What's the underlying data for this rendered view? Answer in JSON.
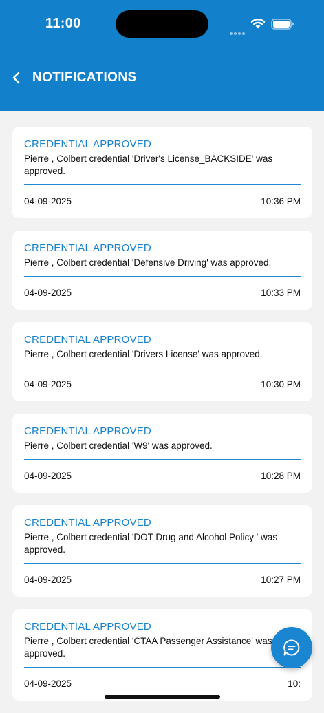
{
  "status_bar": {
    "time": "11:00"
  },
  "header": {
    "title": "NOTIFICATIONS"
  },
  "notifications": [
    {
      "title": "CREDENTIAL APPROVED",
      "message": "Pierre , Colbert  credential 'Driver's License_BACKSIDE' was approved.",
      "date": "04-09-2025",
      "time": "10:36 PM"
    },
    {
      "title": "CREDENTIAL APPROVED",
      "message": "Pierre , Colbert  credential 'Defensive Driving' was approved.",
      "date": "04-09-2025",
      "time": "10:33 PM"
    },
    {
      "title": "CREDENTIAL APPROVED",
      "message": "Pierre , Colbert  credential 'Drivers License' was approved.",
      "date": "04-09-2025",
      "time": "10:30 PM"
    },
    {
      "title": "CREDENTIAL APPROVED",
      "message": "Pierre , Colbert  credential 'W9' was approved.",
      "date": "04-09-2025",
      "time": "10:28 PM"
    },
    {
      "title": "CREDENTIAL APPROVED",
      "message": "Pierre , Colbert  credential 'DOT Drug and Alcohol Policy ' was approved.",
      "date": "04-09-2025",
      "time": "10:27 PM"
    },
    {
      "title": "CREDENTIAL APPROVED",
      "message": "Pierre , Colbert  credential 'CTAA Passenger Assistance' was approved.",
      "date": "04-09-2025",
      "time": "10:"
    }
  ],
  "icons": {
    "back": "chevron-left-icon",
    "fab": "chat-icon",
    "wifi": "wifi-icon",
    "battery": "battery-icon"
  },
  "colors": {
    "header_bg": "#1380cc",
    "accent": "#1a82c9",
    "background": "#f2f2f2",
    "card_bg": "#ffffff"
  }
}
